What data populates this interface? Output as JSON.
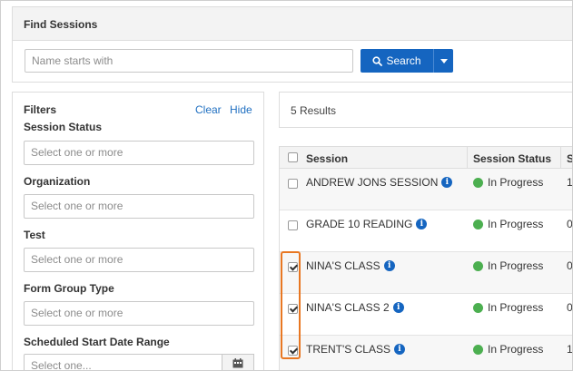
{
  "panel": {
    "title": "Find Sessions"
  },
  "search": {
    "placeholder": "Name starts with",
    "button_label": "Search"
  },
  "filters": {
    "title": "Filters",
    "clear_label": "Clear",
    "hide_label": "Hide",
    "session_status": {
      "label": "Session Status",
      "placeholder": "Select one or more"
    },
    "organization": {
      "label": "Organization",
      "placeholder": "Select one or more"
    },
    "test": {
      "label": "Test",
      "placeholder": "Select one or more"
    },
    "form_group_type": {
      "label": "Form Group Type",
      "placeholder": "Select one or more"
    },
    "scheduled_start": {
      "label": "Scheduled Start Date Range",
      "placeholder": "Select one..."
    }
  },
  "results": {
    "count_label": "5 Results",
    "columns": [
      "Session",
      "Session Status",
      "S"
    ],
    "rows": [
      {
        "session": "ANDREW JONS SESSION",
        "status": "In Progress",
        "trail": "1",
        "checked": false
      },
      {
        "session": "GRADE 10 READING",
        "status": "In Progress",
        "trail": "0",
        "checked": false
      },
      {
        "session": "NINA'S CLASS",
        "status": "In Progress",
        "trail": "0",
        "checked": true
      },
      {
        "session": "NINA'S CLASS 2",
        "status": "In Progress",
        "trail": "0",
        "checked": true
      },
      {
        "session": "TRENT'S CLASS",
        "status": "In Progress",
        "trail": "1",
        "checked": true
      }
    ]
  },
  "colors": {
    "primary_button": "#1565c0",
    "link": "#1f6fc1",
    "status_dot": "#4caf50",
    "highlight": "#e87722"
  }
}
